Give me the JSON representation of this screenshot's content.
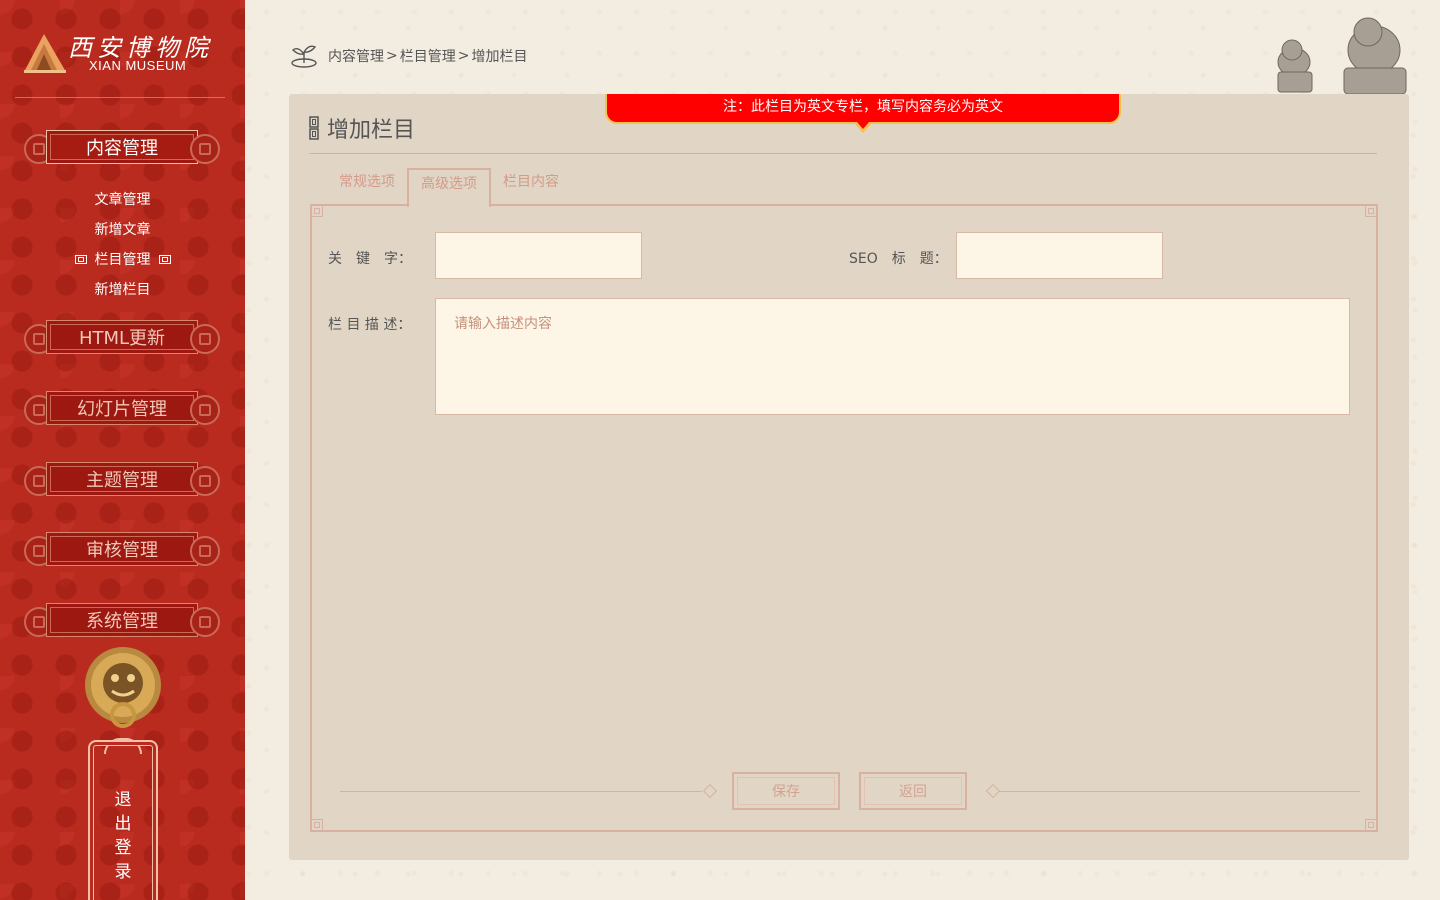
{
  "brand": {
    "name_cn": "西安博物院",
    "name_en": "XIAN MUSEUM"
  },
  "sidebar": {
    "menus": [
      {
        "label": "内容管理",
        "active": true
      },
      {
        "label": "HTML更新"
      },
      {
        "label": "幻灯片管理"
      },
      {
        "label": "主题管理"
      },
      {
        "label": "审核管理"
      },
      {
        "label": "系统管理"
      }
    ],
    "submenu": [
      {
        "label": "文章管理"
      },
      {
        "label": "新增文章"
      },
      {
        "label": "栏目管理",
        "current": true
      },
      {
        "label": "新增栏目"
      }
    ],
    "logout_label": "退出登录"
  },
  "breadcrumb": {
    "items": [
      "内容管理",
      "栏目管理",
      "增加栏目"
    ],
    "separator": ">"
  },
  "notice": "注：此栏目为英文专栏，填写内容务必为英文",
  "panel": {
    "title": "增加栏目",
    "tabs": [
      {
        "label": "常规选项"
      },
      {
        "label": "高级选项",
        "active": true
      },
      {
        "label": "栏目内容"
      }
    ]
  },
  "form": {
    "keywords_label": "关　键　字：",
    "keywords_value": "",
    "seo_title_label": "SEO　标　题：",
    "seo_title_value": "",
    "description_label": "栏 目 描 述：",
    "description_placeholder": "请输入描述内容",
    "save_label": "保存",
    "back_label": "返回"
  },
  "colors": {
    "sidebar_bg": "#b92a1f",
    "panel_bg": "#e1d6c5",
    "notice_bg": "#ff0000",
    "accent_border": "#d8b1a0"
  }
}
